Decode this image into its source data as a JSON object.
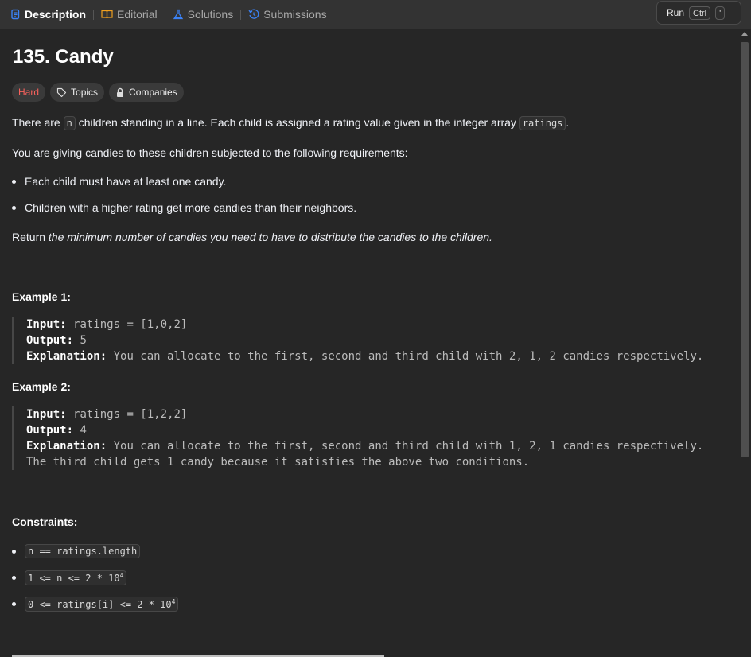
{
  "tabs": [
    {
      "label": "Description",
      "icon": "description-icon",
      "active": true
    },
    {
      "label": "Editorial",
      "icon": "book-icon",
      "active": false
    },
    {
      "label": "Solutions",
      "icon": "flask-icon",
      "active": false
    },
    {
      "label": "Submissions",
      "icon": "history-icon",
      "active": false
    }
  ],
  "run": {
    "label": "Run",
    "key1": "Ctrl",
    "key2": "'"
  },
  "problem": {
    "title": "135. Candy",
    "difficulty": "Hard",
    "topics_label": "Topics",
    "companies_label": "Companies"
  },
  "description": {
    "p1_a": "There are ",
    "p1_code1": "n",
    "p1_b": " children standing in a line. Each child is assigned a rating value given in the integer array ",
    "p1_code2": "ratings",
    "p1_c": ".",
    "p2": "You are giving candies to these children subjected to the following requirements:",
    "bullets": [
      "Each child must have at least one candy.",
      "Children with a higher rating get more candies than their neighbors."
    ],
    "p3_a": "Return ",
    "p3_b": "the minimum number of candies you need to have to distribute the candies to the children."
  },
  "examples": [
    {
      "title": "Example 1:",
      "input": "ratings = [1,0,2]",
      "output": "5",
      "explanation": "You can allocate to the first, second and third child with 2, 1, 2 candies respectively.",
      "extra": ""
    },
    {
      "title": "Example 2:",
      "input": "ratings = [1,2,2]",
      "output": "4",
      "explanation": "You can allocate to the first, second and third child with 1, 2, 1 candies respectively.",
      "extra": "The third child gets 1 candy because it satisfies the above two conditions."
    }
  ],
  "labels": {
    "input": "Input:",
    "output": "Output:",
    "explanation": "Explanation:"
  },
  "constraints": {
    "title": "Constraints:",
    "items": [
      {
        "text": "n == ratings.length",
        "sup": ""
      },
      {
        "text": "1 <= n <= 2 * 10",
        "sup": "4"
      },
      {
        "text": "0 <= ratings[i] <= 2 * 10",
        "sup": "4"
      }
    ]
  },
  "colors": {
    "accent_hard": "#f8615c",
    "tab_description_icon": "#3b82f6",
    "tab_editorial_icon": "#f0a020"
  }
}
